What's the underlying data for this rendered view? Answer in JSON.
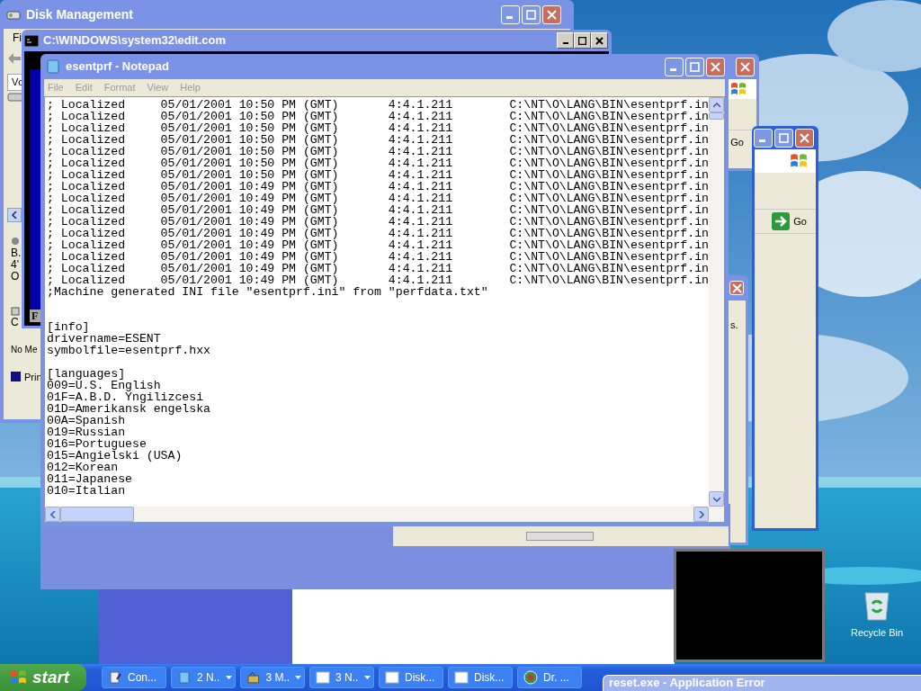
{
  "desktop": {
    "icons": [
      {
        "label": "Recycle Bin"
      }
    ]
  },
  "disk_management": {
    "title": "Disk Management",
    "menu_fragment": "Fi",
    "column_fragment": "Vc",
    "disk_fragments": [
      "B.",
      "4'",
      "O"
    ],
    "cd_fragment": "C",
    "status_fragment": "No Me",
    "legend_fragment": "Prin"
  },
  "edit_window": {
    "title": "C:\\WINDOWS\\system32\\edit.com",
    "fragment": "F"
  },
  "browser_windows": [
    {
      "go_label": "Go"
    },
    {
      "go_label": "Go"
    }
  ],
  "dialog_fragment": {
    "text": "s."
  },
  "notepad": {
    "title": "esentprf - Notepad",
    "menu": [
      "File",
      "Edit",
      "Format",
      "View",
      "Help"
    ],
    "blocks": [
      [
        "; Localized     05/01/2001 10:50 PM (GMT)       4:4.1.211        C:\\NT\\O\\LANG\\BIN\\esentprf.in",
        "; Localized     05/01/2001 10:50 PM (GMT)       4:4.1.211        C:\\NT\\O\\LANG\\BIN\\esentprf.in",
        "; Localized     05/01/2001 10:50 PM (GMT)       4:4.1.211        C:\\NT\\O\\LANG\\BIN\\esentprf.in",
        "; Localized     05/01/2001 10:50 PM (GMT)       4:4.1.211        C:\\NT\\O\\LANG\\BIN\\esentprf.in",
        "; Localized     05/01/2001 10:50 PM (GMT)       4:4.1.211        C:\\NT\\O\\LANG\\BIN\\esentprf.in",
        "; Localized     05/01/2001 10:50 PM (GMT)       4:4.1.211        C:\\NT\\O\\LANG\\BIN\\esentprf.in",
        "; Localized     05/01/2001 10:50 PM (GMT)       4:4.1.211        C:\\NT\\O\\LANG\\BIN\\esentprf.in",
        "; Localized     05/01/2001 10:49 PM (GMT)       4:4.1.211        C:\\NT\\O\\LANG\\BIN\\esentprf.in",
        "; Localized     05/01/2001 10:49 PM (GMT)       4:4.1.211        C:\\NT\\O\\LANG\\BIN\\esentprf.in",
        "; Localized     05/01/2001 10:49 PM (GMT)       4:4.1.211        C:\\NT\\O\\LANG\\BIN\\esentprf.in",
        "; Localized     05/01/2001 10:49 PM (GMT)       4:4.1.211        C:\\NT\\O\\LANG\\BIN\\esentprf.in",
        "; Localized     05/01/2001 10:49 PM (GMT)       4:4.1.211        C:\\NT\\O\\LANG\\BIN\\esentprf.in",
        "; Localized     05/01/2001 10:49 PM (GMT)       4:4.1.211        C:\\NT\\O\\LANG\\BIN\\esentprf.in",
        "; Localized     05/01/2001 10:49 PM (GMT)       4:4.1.211        C:\\NT\\O\\LANG\\BIN\\esentprf.in",
        "; Localized     05/01/2001 10:49 PM (GMT)       4:4.1.211        C:\\NT\\O\\LANG\\BIN\\esentprf.in",
        "; Localized     05/01/2001 10:49 PM (GMT)       4:4.1.211        C:\\NT\\O\\LANG\\BIN\\esentprf.in",
        ";Machine generated INI file \"esentprf.ini\" from \"perfdata.txt\""
      ],
      [
        "[info]",
        "drivername=ESENT",
        "symbolfile=esentprf.hxx"
      ],
      [
        "[languages]",
        "009=U.S. English",
        "01F=A.B.D. Yngilizcesi",
        "01D=Amerikansk engelska",
        "00A=Spanish",
        "019=Russian",
        "016=Portuguese",
        "015=Angielski (USA)",
        "012=Korean",
        "011=Japanese",
        "010=Italian"
      ]
    ]
  },
  "taskbar": {
    "start": "start",
    "items": [
      {
        "label": "Con...",
        "kind": "single"
      },
      {
        "label": "2 N..",
        "kind": "group"
      },
      {
        "label": "3 M..",
        "kind": "group"
      },
      {
        "label": "3 N..",
        "kind": "group"
      },
      {
        "label": "Disk...",
        "kind": "single"
      },
      {
        "label": "Disk...",
        "kind": "single"
      },
      {
        "label": "Dr. ...",
        "kind": "single"
      }
    ]
  },
  "error_window": {
    "title": "reset.exe - Application Error"
  }
}
